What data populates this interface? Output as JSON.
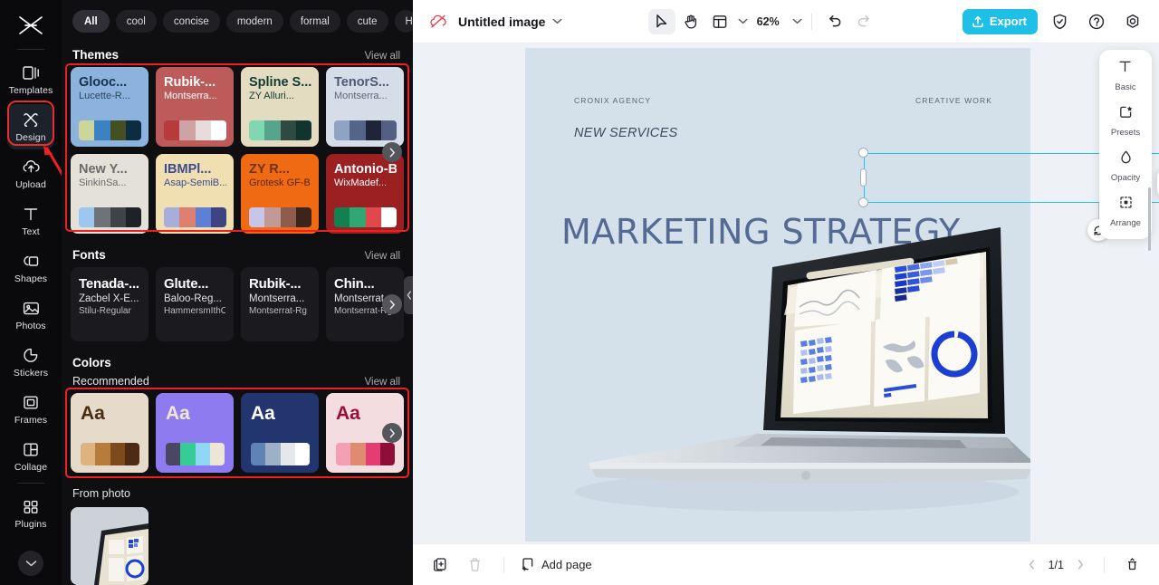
{
  "rail": {
    "logo": "app-logo",
    "items": [
      {
        "label": "Templates",
        "icon": "templates-icon",
        "active": false
      },
      {
        "label": "Design",
        "icon": "design-icon",
        "active": true
      },
      {
        "label": "Upload",
        "icon": "upload-cloud-icon",
        "active": false
      },
      {
        "label": "Text",
        "icon": "text-icon",
        "active": false
      },
      {
        "label": "Shapes",
        "icon": "shapes-icon",
        "active": false
      },
      {
        "label": "Photos",
        "icon": "photos-icon",
        "active": false
      },
      {
        "label": "Stickers",
        "icon": "stickers-icon",
        "active": false
      },
      {
        "label": "Frames",
        "icon": "frames-icon",
        "active": false
      },
      {
        "label": "Collage",
        "icon": "collage-icon",
        "active": false
      },
      {
        "label": "Plugins",
        "icon": "plugins-icon",
        "active": false
      }
    ],
    "expand_icon": "chevron-down-icon",
    "highlight_color": "#ef2020"
  },
  "panel": {
    "filters": [
      {
        "label": "All",
        "active": true
      },
      {
        "label": "cool",
        "active": false
      },
      {
        "label": "concise",
        "active": false
      },
      {
        "label": "modern",
        "active": false
      },
      {
        "label": "formal",
        "active": false
      },
      {
        "label": "cute",
        "active": false
      },
      {
        "label": "Holiday",
        "active": false
      }
    ],
    "filters_more_icon": "chevron-down-icon",
    "themes": {
      "title": "Themes",
      "view_all": "View all",
      "next_icon": "chevron-right-icon",
      "cards": [
        {
          "font1": "Glooc...",
          "font2": "Lucette-R...",
          "bg": "#8cb3de",
          "fg1": "#16324f",
          "fg2": "#2c4964",
          "swatches": [
            "#ccd69a",
            "#3b82c4",
            "#44501f",
            "#0e2c3f"
          ]
        },
        {
          "font1": "Rubik-...",
          "font2": "Montserra...",
          "bg": "#bd5b5b",
          "fg1": "#ffffff",
          "fg2": "#ffffff",
          "swatches": [
            "#b73a3c",
            "#cda3a3",
            "#e7dcdb",
            "#ffffff"
          ]
        },
        {
          "font1": "Spline S...",
          "font2": "ZY Alluri...",
          "bg": "#e3dcc0",
          "fg1": "#0f3a33",
          "fg2": "#0f3a33",
          "swatches": [
            "#7fd8b0",
            "#55a48b",
            "#2e4a42",
            "#11342f"
          ]
        },
        {
          "font1": "TenorS...",
          "font2": "Montserra...",
          "bg": "#d4dde8",
          "fg1": "#4e5a72",
          "fg2": "#5d6878",
          "swatches": [
            "#8fa3c4",
            "#56648c",
            "#1f2438",
            "#545f82"
          ]
        },
        {
          "font1": "New Y...",
          "font2": "SinkinSa...",
          "bg": "#e4e1d9",
          "fg1": "#6a6a6a",
          "fg2": "#6a6a6a",
          "swatches": [
            "#9dc7ef",
            "#6f7378",
            "#3e4348",
            "#1e2126"
          ]
        },
        {
          "font1": "IBMPl...",
          "font2": "Asap-SemiB...",
          "bg": "#f0dfb0",
          "fg1": "#3b4a93",
          "fg2": "#3b4a93",
          "swatches": [
            "#a8aedc",
            "#dd8071",
            "#5f7fd4",
            "#3c4483"
          ]
        },
        {
          "font1": "ZY R...",
          "font2": "Grotesk GF-B...",
          "bg": "#f06a13",
          "fg1": "#6e3410",
          "fg2": "#572808",
          "swatches": [
            "#c6c5ea",
            "#c29a95",
            "#8c5c4e",
            "#3d241a"
          ]
        },
        {
          "font1": "Antonio-Bold",
          "font2": "WixMadef...",
          "bg": "#9c1f22",
          "fg1": "#ffffff",
          "fg2": "#ffffff",
          "swatches": [
            "#128050",
            "#2fa873",
            "#e2474b",
            "#ffffff"
          ]
        }
      ]
    },
    "fonts": {
      "title": "Fonts",
      "view_all": "View all",
      "next_icon": "chevron-right-icon",
      "cards": [
        {
          "l1": "Tenada-...",
          "l2": "Zacbel X-E...",
          "l3": "Stilu-Regular"
        },
        {
          "l1": "Glute...",
          "l2": "Baloo-Reg...",
          "l3": "HammersmIthOn..."
        },
        {
          "l1": "Rubik-...",
          "l2": "Montserra...",
          "l3": "Montserrat-Rg"
        },
        {
          "l1": "Chin...",
          "l2": "Montserrat...",
          "l3": "Montserrat-Rg"
        }
      ]
    },
    "colors": {
      "title": "Colors",
      "recommended": "Recommended",
      "view_all": "View all",
      "next_icon": "chevron-right-icon",
      "cards": [
        {
          "aa": "Aa",
          "bg": "#e6dbca",
          "fg": "#4a2b14",
          "swatches": [
            "#ddb480",
            "#b77c3c",
            "#7d4a1b",
            "#4e2c14"
          ]
        },
        {
          "aa": "Aa",
          "bg": "#8f7bf0",
          "fg": "#efe7d2",
          "swatches": [
            "#4a4663",
            "#35cc97",
            "#8fd7f5",
            "#eee6d4"
          ]
        },
        {
          "aa": "Aa",
          "bg": "#22356f",
          "fg": "#ffffff",
          "swatches": [
            "#5f83b5",
            "#9eb0c6",
            "#e4e8ec",
            "#ffffff"
          ]
        },
        {
          "aa": "Aa",
          "bg": "#f4dde0",
          "fg": "#9b0e3c",
          "swatches": [
            "#f4a0b4",
            "#e08a71",
            "#e33d74",
            "#8d0e38"
          ]
        }
      ]
    },
    "from_photo": {
      "title": "From photo"
    },
    "collapse_icon": "chevron-left-icon"
  },
  "topbar": {
    "app_icon": "cloud-slash-icon",
    "doc_title": "Untitled image",
    "doc_chevron_icon": "chevron-down-icon",
    "tools": [
      {
        "name": "select-tool",
        "icon": "cursor-icon",
        "selected": true
      },
      {
        "name": "hand-tool",
        "icon": "hand-icon",
        "selected": false
      },
      {
        "name": "layout-tool",
        "icon": "layout-icon",
        "selected": false
      }
    ],
    "layout_chevron_icon": "chevron-down-icon",
    "zoom": "62%",
    "zoom_chevron_icon": "chevron-down-icon",
    "undo_icon": "undo-icon",
    "redo_icon": "redo-icon",
    "export_label": "Export",
    "export_icon": "upload-icon",
    "export_color": "#1ec0e8",
    "shield_icon": "shield-check-icon",
    "help_icon": "help-circle-icon",
    "settings_icon": "gear-icon"
  },
  "canvas": {
    "bg_color": "#d4e0ea",
    "top_left_label": "CRONIX AGENCY",
    "top_right_label": "CREATIVE WORK",
    "subtitle": "NEW SERVICES",
    "title": "MARKETING STRATEGY",
    "title_color": "#556a92",
    "selection_color": "#21c3e8",
    "float_toolbar": [
      {
        "name": "magic-edit-button",
        "icon": "magic-wand-icon"
      },
      {
        "name": "magic-edit-chevron",
        "icon": "chevron-down-icon"
      },
      {
        "name": "duplicate-button",
        "icon": "duplicate-icon"
      },
      {
        "name": "more-options-button",
        "icon": "ellipsis-icon"
      }
    ],
    "rotate_icon": "rotate-icon"
  },
  "right_panel": {
    "items": [
      {
        "label": "Basic",
        "icon": "text-t-icon"
      },
      {
        "label": "Presets",
        "icon": "presets-star-icon"
      },
      {
        "label": "Opacity",
        "icon": "opacity-drop-icon"
      },
      {
        "label": "Arrange",
        "icon": "arrange-icon"
      }
    ]
  },
  "bottombar": {
    "duplicate_page_icon": "duplicate-page-icon",
    "delete_page_icon": "trash-icon",
    "add_page_label": "Add page",
    "add_page_icon": "add-page-icon",
    "prev_icon": "chevron-left-icon",
    "page_indicator": "1/1",
    "next_icon": "chevron-right-icon",
    "pin_icon": "pin-icon"
  }
}
